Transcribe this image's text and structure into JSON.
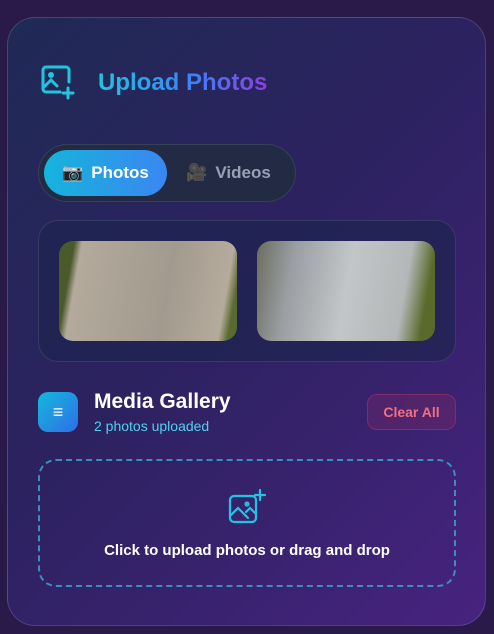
{
  "header": {
    "title": "Upload Photos",
    "icon": "image-plus-icon"
  },
  "tabs": [
    {
      "label": "Photos",
      "icon": "📷",
      "active": true
    },
    {
      "label": "Videos",
      "icon": "🎥",
      "active": false
    }
  ],
  "gallery": {
    "title": "Media Gallery",
    "count_text": "2 photos uploaded",
    "clear_label": "Clear All",
    "menu_icon": "≡"
  },
  "dropzone": {
    "text": "Click to upload photos or drag and drop",
    "icon": "image-plus-icon"
  },
  "colors": {
    "accent": "#22c5e0",
    "danger": "#f07080"
  }
}
